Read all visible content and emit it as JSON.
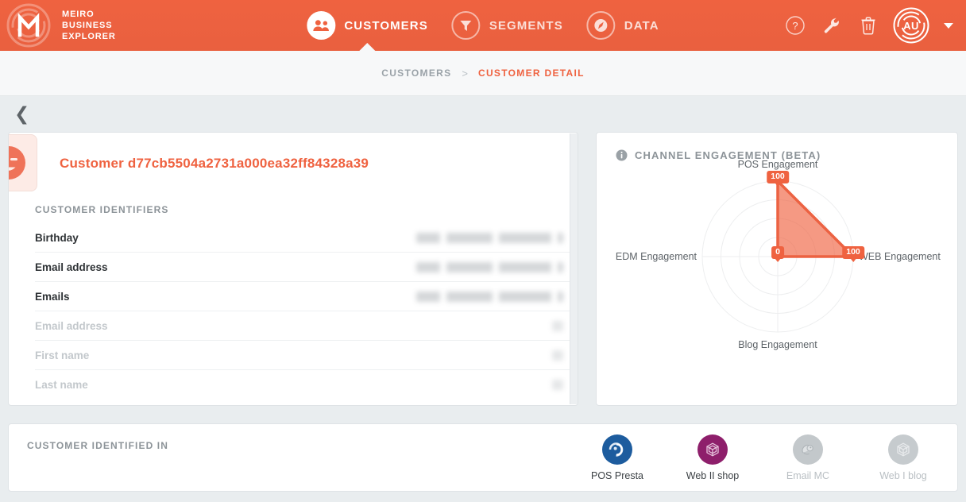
{
  "brand": {
    "logo_icon": "meiro-maze-logo-icon",
    "name_lines": [
      "MEIRO",
      "BUSINESS",
      "EXPLORER"
    ],
    "line1": "MEIRO",
    "line2": "BUSINESS",
    "line3": "EXPLORER"
  },
  "nav": {
    "items": [
      {
        "label": "CUSTOMERS",
        "icon": "customers-group-icon",
        "active": true
      },
      {
        "label": "SEGMENTS",
        "icon": "funnel-icon",
        "active": false
      },
      {
        "label": "DATA",
        "icon": "gauge-icon",
        "active": false
      }
    ],
    "item0": "CUSTOMERS",
    "item1": "SEGMENTS",
    "item2": "DATA"
  },
  "topright": {
    "help_icon": "question-mark-circle-icon",
    "tools_icon": "wrench-icon",
    "trash_icon": "trash-icon",
    "avatar_initials": "AU",
    "caret_icon": "chevron-down-icon"
  },
  "breadcrumb": {
    "parent": "CUSTOMERS",
    "separator": ">",
    "current": "CUSTOMER DETAIL"
  },
  "back": {
    "icon": "chevron-left-icon"
  },
  "customer": {
    "avatar_icon": "winking-face-icon",
    "title": "Customer d77cb5504a2731a000ea32ff84328a39",
    "identifiers_label": "CUSTOMER IDENTIFIERS",
    "rows": [
      {
        "key": "Birthday",
        "value": "",
        "redacted": true,
        "muted": false
      },
      {
        "key": "Email address",
        "value": "",
        "redacted": true,
        "muted": false
      },
      {
        "key": "Emails",
        "value": "",
        "redacted": true,
        "muted": false
      },
      {
        "key": "Email address",
        "value": "",
        "redacted": false,
        "muted": true
      },
      {
        "key": "First name",
        "value": "",
        "redacted": false,
        "muted": true
      },
      {
        "key": "Last name",
        "value": "",
        "redacted": false,
        "muted": true
      }
    ],
    "row0": "Birthday",
    "row1": "Email address",
    "row2": "Emails",
    "row3": "Email address",
    "row4": "First name",
    "row5": "Last name"
  },
  "engagement_panel": {
    "info_icon": "info-circle-icon",
    "title": "CHANNEL ENGAGEMENT (BETA)"
  },
  "chart_data": {
    "type": "radar",
    "title": "CHANNEL ENGAGEMENT (BETA)",
    "categories": [
      "POS Engagement",
      "WEB Engagement",
      "Blog Engagement",
      "EDM Engagement"
    ],
    "values": [
      100,
      100,
      0,
      0
    ],
    "point_labels": [
      "100",
      "100",
      "0",
      "0"
    ],
    "rlim": [
      0,
      100
    ],
    "rings": 4,
    "grid": true,
    "legend": "none",
    "fill_color": "#ef6240",
    "fill_opacity": 0.65,
    "label_color": "#5d6368",
    "cat0": "POS Engagement",
    "cat1": "WEB Engagement",
    "cat2": "Blog Engagement",
    "cat3": "EDM Engagement",
    "v0": "100",
    "v1": "100",
    "v2": "0",
    "v3": "0"
  },
  "identified_in": {
    "label": "CUSTOMER IDENTIFIED IN",
    "sources": [
      {
        "name": "POS Presta",
        "icon": "prestashop-icon",
        "active": true,
        "color": "#1d5c9e"
      },
      {
        "name": "Web II shop",
        "icon": "hexagon-web-icon",
        "active": true,
        "color": "#8e1f6b"
      },
      {
        "name": "Email MC",
        "icon": "mailchimp-icon",
        "active": false,
        "color": "#bfc4c7"
      },
      {
        "name": "Web I blog",
        "icon": "hexagon-blog-icon",
        "active": false,
        "color": "#c4c9cc"
      }
    ],
    "s0": "POS Presta",
    "s1": "Web II shop",
    "s2": "Email MC",
    "s3": "Web I blog"
  },
  "colors": {
    "brand": "#ef6240",
    "page_bg": "#e9edef",
    "card_bg": "#ffffff",
    "muted_text": "#8c9398"
  }
}
